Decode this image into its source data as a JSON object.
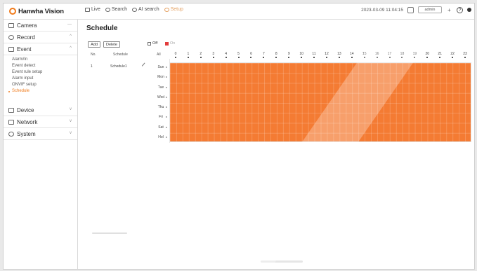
{
  "app": {
    "logo_text": "Hanwha Vision",
    "brand_color": "#f07a1a"
  },
  "topnav": [
    {
      "label": "Live",
      "icon": "monitor-icon"
    },
    {
      "label": "Search",
      "icon": "search-icon"
    },
    {
      "label": "AI search",
      "icon": "ai-search-icon"
    },
    {
      "label": "Setup",
      "icon": "gear-icon"
    }
  ],
  "topbar_right": {
    "datetime": "2023-03-09 11:04:15",
    "user": "admin"
  },
  "sidebar": {
    "sections": [
      {
        "label": "Camera",
        "icon": "camera-icon",
        "expanded": false
      },
      {
        "label": "Record",
        "icon": "record-icon",
        "expanded": true
      },
      {
        "label": "Event",
        "icon": "event-icon",
        "expanded": true
      }
    ],
    "event_items": [
      {
        "label": "Alarm/In"
      },
      {
        "label": "Event detect"
      },
      {
        "label": "Event rule setup"
      },
      {
        "label": "Alarm input"
      },
      {
        "label": "ONVIF setup"
      },
      {
        "label": "Schedule",
        "active": true
      }
    ],
    "lower_sections": [
      {
        "label": "Device",
        "icon": "device-icon"
      },
      {
        "label": "Network",
        "icon": "network-icon"
      },
      {
        "label": "System",
        "icon": "system-icon"
      }
    ]
  },
  "page": {
    "title": "Schedule",
    "add_label": "Add",
    "delete_label": "Delete",
    "legend_off": "Off",
    "legend_on": "On",
    "legend_on_color": "#e23b3b"
  },
  "table": {
    "headers": {
      "no": "No.",
      "schedule": "Schedule",
      "all": "All"
    },
    "rows": [
      {
        "no": "1",
        "name": "Schedule1"
      }
    ],
    "hours": [
      "0",
      "1",
      "2",
      "3",
      "4",
      "5",
      "6",
      "7",
      "8",
      "9",
      "10",
      "11",
      "12",
      "13",
      "14",
      "15",
      "16",
      "17",
      "18",
      "19",
      "20",
      "21",
      "22",
      "23"
    ],
    "days": [
      "Sun",
      "Mon",
      "Tue",
      "Wed",
      "Thu",
      "Fri",
      "Sat",
      "Hol"
    ],
    "fill_color": "#f47b33"
  }
}
